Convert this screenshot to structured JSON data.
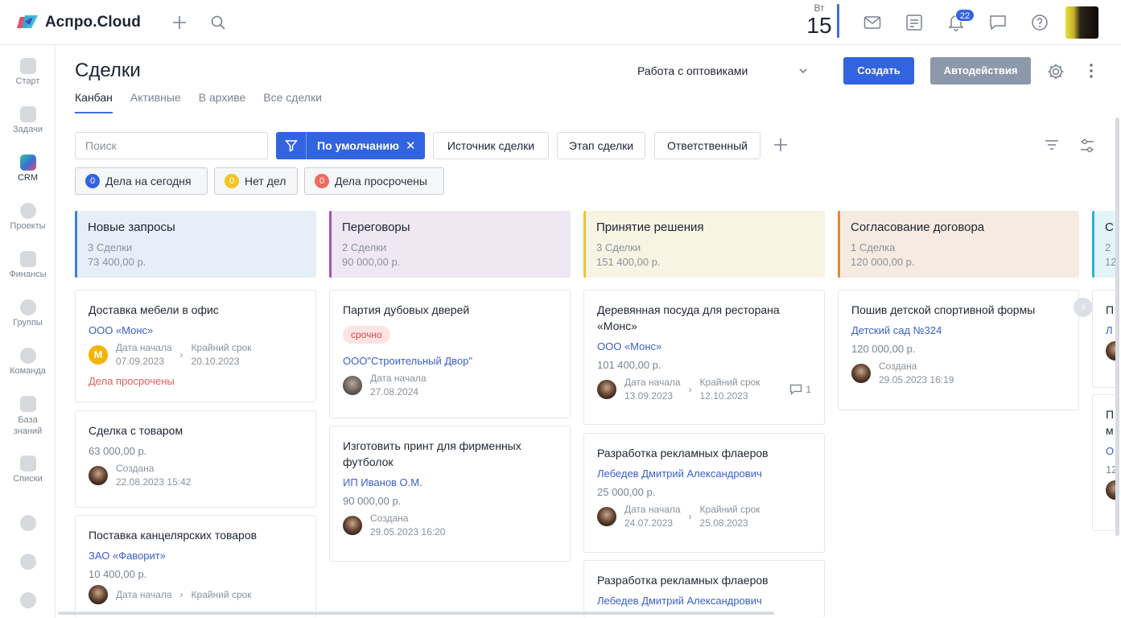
{
  "app": {
    "name": "Аспро.Cloud"
  },
  "topbar": {
    "date_dow": "Вт",
    "date_day": "15",
    "notifications_count": "22"
  },
  "sidebar": {
    "items": [
      {
        "label": "Старт",
        "icon": "heart-icon"
      },
      {
        "label": "Задачи",
        "icon": "check-icon"
      },
      {
        "label": "CRM",
        "icon": "crm-icon"
      },
      {
        "label": "Проекты",
        "icon": "projects-icon"
      },
      {
        "label": "Финансы",
        "icon": "finance-icon"
      },
      {
        "label": "Группы",
        "icon": "groups-icon"
      },
      {
        "label": "Команда",
        "icon": "team-icon"
      },
      {
        "label": "База знаний",
        "icon": "knowledge-icon"
      },
      {
        "label": "Списки",
        "icon": "lists-icon"
      }
    ]
  },
  "page": {
    "title": "Сделки",
    "tabs": [
      "Канбан",
      "Активные",
      "В архиве",
      "Все сделки"
    ],
    "funnel": "Работа с оптовиками",
    "create_label": "Создать",
    "auto_label": "Автодействия"
  },
  "filters": {
    "search_placeholder": "Поиск",
    "default_chip": "По умолчанию",
    "chips": [
      "Источник сделки",
      "Этап сделки",
      "Ответственный"
    ],
    "pills": [
      {
        "count": "0",
        "label": "Дела на сегодня",
        "color": "#3264e0"
      },
      {
        "count": "0",
        "label": "Нет дел",
        "color": "#f3c623"
      },
      {
        "count": "0",
        "label": "Дела просрочены",
        "color": "#ef6b5d"
      }
    ]
  },
  "board": {
    "columns": [
      {
        "name": "Новые запросы",
        "count": "3 Сделки",
        "sum": "73 400,00 р.",
        "accent": "#3b82d6",
        "bg": "#e6eff8"
      },
      {
        "name": "Переговоры",
        "count": "2 Сделки",
        "sum": "90 000,00 р.",
        "accent": "#9b59b6",
        "bg": "#efe8f3"
      },
      {
        "name": "Принятие решения",
        "count": "3 Сделки",
        "sum": "151 400,00 р.",
        "accent": "#f0c43a",
        "bg": "#f8f4e3"
      },
      {
        "name": "Согласование договора",
        "count": "1 Сделка",
        "sum": "120 000,00 р.",
        "accent": "#e68a2e",
        "bg": "#f6ebe1"
      },
      {
        "name": "С",
        "count": "2",
        "sum": "12",
        "accent": "#2bb6d9",
        "bg": "#e4f3f8"
      }
    ],
    "cards": {
      "c1": {
        "title": "Доставка мебели в офис",
        "link": "ООО «Монс»",
        "start_label": "Дата начала",
        "start": "07.09.2023",
        "due_label": "Крайний срок",
        "due": "20.10.2023",
        "overdue": "Дела просрочены",
        "avatar_letter": "М"
      },
      "c2": {
        "title": "Сделка с товаром",
        "amount": "63 000,00 р.",
        "created_label": "Создана",
        "created": "22.08.2023 15:42"
      },
      "c3": {
        "title": "Поставка канцелярских товаров",
        "link": "ЗАО «Фаворит»",
        "amount": "10 400,00 р.",
        "start_label": "Дата начала",
        "due_label": "Крайний срок"
      },
      "c4": {
        "title": "Партия дубовых дверей",
        "tag": "срочно",
        "link": "ООО\"Строительный Двор\"",
        "start_label": "Дата начала",
        "start": "27.08.2024"
      },
      "c5": {
        "title": "Изготовить принт для фирменных футболок",
        "link": "ИП Иванов О.М.",
        "amount": "90 000,00 р.",
        "created_label": "Создана",
        "created": "29.05.2023 16:20"
      },
      "c6": {
        "title": "Деревянная посуда для ресторана «Монс»",
        "link": "ООО «Монс»",
        "amount": "101 400,00 р.",
        "start_label": "Дата начала",
        "start": "13.09.2023",
        "due_label": "Крайний срок",
        "due": "12.10.2023",
        "comments": "1"
      },
      "c7": {
        "title": "Разработка рекламных флаеров",
        "link": "Лебедев Дмитрий Александрович",
        "amount": "25 000,00 р.",
        "start_label": "Дата начала",
        "start": "24.07.2023",
        "due_label": "Крайний срок",
        "due": "25.08.2023"
      },
      "c8": {
        "title": "Разработка рекламных флаеров",
        "link": "Лебедев Дмитрий Александрович"
      },
      "c9": {
        "title": "Пошив детской спортивной формы",
        "link": "Детский сад №324",
        "amount": "120 000,00 р.",
        "created_label": "Создана",
        "created": "29.05.2023 16:19"
      },
      "c10": {
        "title": "П",
        "link": "Л"
      },
      "c11": {
        "title": "П",
        "title2": "м",
        "link": "О",
        "amount": "12"
      }
    }
  }
}
